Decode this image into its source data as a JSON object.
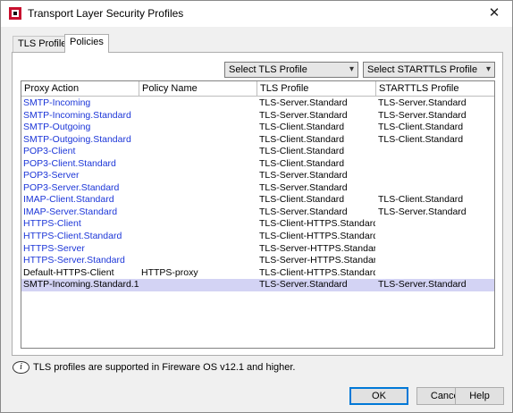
{
  "window": {
    "title": "Transport Layer Security Profiles",
    "close_glyph": "✕"
  },
  "tabs": [
    {
      "label": "TLS Profiles",
      "active": false
    },
    {
      "label": "Policies",
      "active": true
    }
  ],
  "selects": {
    "tls_profile": "Select TLS Profile",
    "starttls_profile": "Select STARTTLS Profile"
  },
  "table": {
    "headers": [
      "Proxy Action",
      "Policy Name",
      "TLS Profile",
      "STARTTLS Profile"
    ],
    "rows": [
      {
        "proxy_action": "SMTP-Incoming",
        "policy_name": "",
        "tls_profile": "TLS-Server.Standard",
        "starttls_profile": "TLS-Server.Standard",
        "link": true
      },
      {
        "proxy_action": "SMTP-Incoming.Standard",
        "policy_name": "",
        "tls_profile": "TLS-Server.Standard",
        "starttls_profile": "TLS-Server.Standard",
        "link": true
      },
      {
        "proxy_action": "SMTP-Outgoing",
        "policy_name": "",
        "tls_profile": "TLS-Client.Standard",
        "starttls_profile": "TLS-Client.Standard",
        "link": true
      },
      {
        "proxy_action": "SMTP-Outgoing.Standard",
        "policy_name": "",
        "tls_profile": "TLS-Client.Standard",
        "starttls_profile": "TLS-Client.Standard",
        "link": true
      },
      {
        "proxy_action": "POP3-Client",
        "policy_name": "",
        "tls_profile": "TLS-Client.Standard",
        "starttls_profile": "",
        "link": true
      },
      {
        "proxy_action": "POP3-Client.Standard",
        "policy_name": "",
        "tls_profile": "TLS-Client.Standard",
        "starttls_profile": "",
        "link": true
      },
      {
        "proxy_action": "POP3-Server",
        "policy_name": "",
        "tls_profile": "TLS-Server.Standard",
        "starttls_profile": "",
        "link": true
      },
      {
        "proxy_action": "POP3-Server.Standard",
        "policy_name": "",
        "tls_profile": "TLS-Server.Standard",
        "starttls_profile": "",
        "link": true
      },
      {
        "proxy_action": "IMAP-Client.Standard",
        "policy_name": "",
        "tls_profile": "TLS-Client.Standard",
        "starttls_profile": "TLS-Client.Standard",
        "link": true
      },
      {
        "proxy_action": "IMAP-Server.Standard",
        "policy_name": "",
        "tls_profile": "TLS-Server.Standard",
        "starttls_profile": "TLS-Server.Standard",
        "link": true
      },
      {
        "proxy_action": "HTTPS-Client",
        "policy_name": "",
        "tls_profile": "TLS-Client-HTTPS.Standard",
        "starttls_profile": "",
        "link": true
      },
      {
        "proxy_action": "HTTPS-Client.Standard",
        "policy_name": "",
        "tls_profile": "TLS-Client-HTTPS.Standard",
        "starttls_profile": "",
        "link": true
      },
      {
        "proxy_action": "HTTPS-Server",
        "policy_name": "",
        "tls_profile": "TLS-Server-HTTPS.Standard",
        "starttls_profile": "",
        "link": true
      },
      {
        "proxy_action": "HTTPS-Server.Standard",
        "policy_name": "",
        "tls_profile": "TLS-Server-HTTPS.Standard",
        "starttls_profile": "",
        "link": true
      },
      {
        "proxy_action": "Default-HTTPS-Client",
        "policy_name": "HTTPS-proxy",
        "tls_profile": "TLS-Client-HTTPS.Standard",
        "starttls_profile": "",
        "link": false
      },
      {
        "proxy_action": "SMTP-Incoming.Standard.1",
        "policy_name": "",
        "tls_profile": "TLS-Server.Standard",
        "starttls_profile": "TLS-Server.Standard",
        "link": false,
        "selected": true
      }
    ]
  },
  "info": {
    "icon": "info-icon",
    "glyph": "i",
    "text": "TLS profiles are supported in Fireware OS v12.1 and higher."
  },
  "buttons": {
    "ok": "OK",
    "cancel": "Cancel",
    "help": "Help"
  },
  "colors": {
    "link": "#1c36d8",
    "selected_row": "#d3d3f4",
    "default_button_border": "#0078d7"
  }
}
